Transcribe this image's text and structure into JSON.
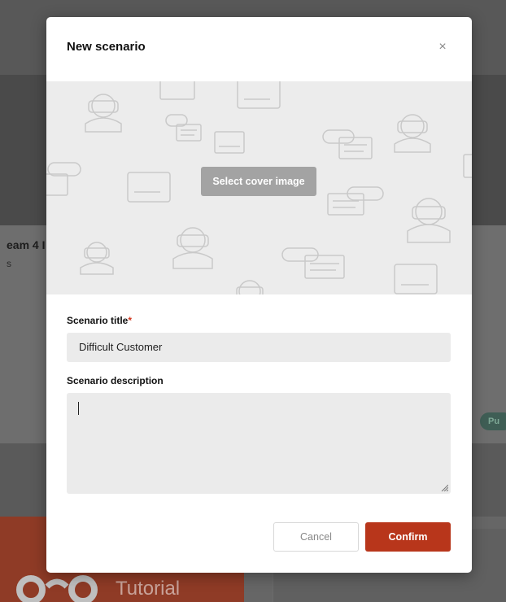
{
  "background": {
    "left_heading": "eam 4 I",
    "left_sub": "s",
    "pill_label": "Pu",
    "tutorial_label": "Tutorial"
  },
  "modal": {
    "title": "New scenario",
    "close_symbol": "×",
    "cover_button_label": "Select cover image",
    "title_field": {
      "label": "Scenario title",
      "required_mark": "*",
      "value": "Difficult Customer"
    },
    "description_field": {
      "label": "Scenario description",
      "value": ""
    },
    "cancel_label": "Cancel",
    "confirm_label": "Confirm"
  },
  "colors": {
    "accent": "#b8361b",
    "required": "#d2391f",
    "field_background": "#ebebeb",
    "cover_background": "#ececec"
  },
  "icons": {
    "close": "close-icon",
    "cover_pattern": "vr-headset-chat-pattern",
    "resize": "resize-handle-icon"
  }
}
